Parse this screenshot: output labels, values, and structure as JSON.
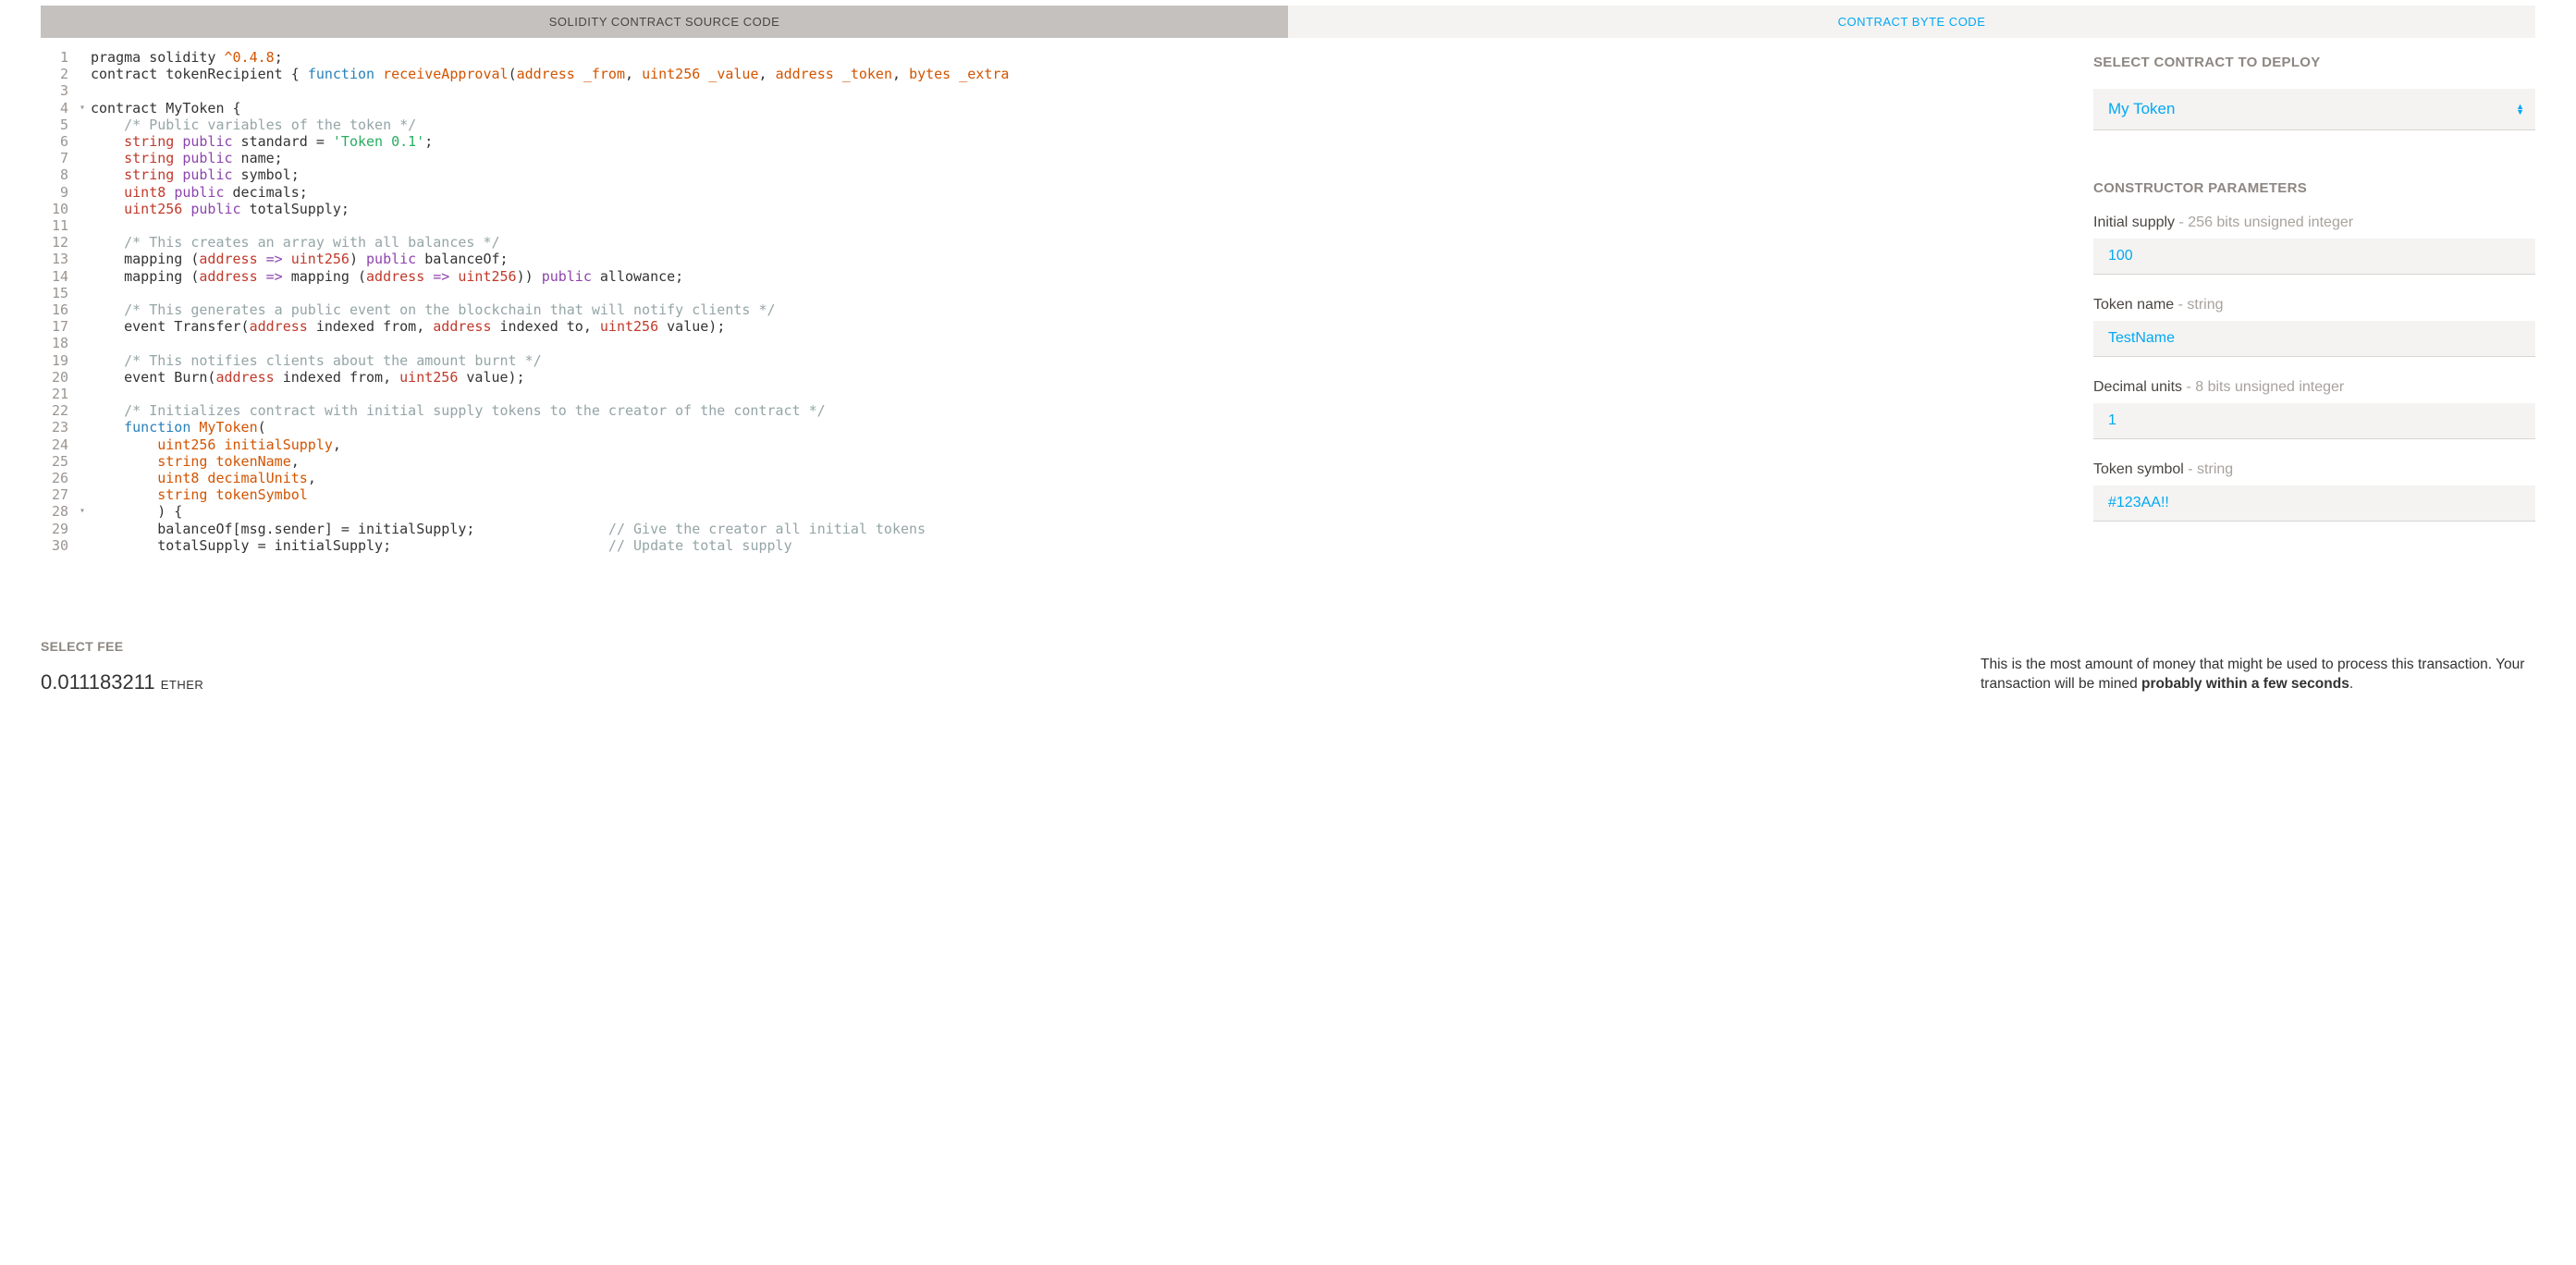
{
  "tabs": {
    "source_label": "SOLIDITY CONTRACT SOURCE CODE",
    "bytecode_label": "CONTRACT BYTE CODE"
  },
  "code": {
    "lines": [
      {
        "n": 1,
        "fold": "",
        "html": "pragma solidity <span class='tok-ver'>^0.4.8</span>;"
      },
      {
        "n": 2,
        "fold": "",
        "html": "contract tokenRecipient { <span class='tok-blue'>function</span> <span class='tok-fn'>receiveApproval</span>(<span class='tok-addr'>address _from</span>, <span class='tok-addr'>uint256 _value</span>, <span class='tok-addr'>address _token</span>, <span class='tok-addr'>bytes _extra</span>"
      },
      {
        "n": 3,
        "fold": "",
        "html": ""
      },
      {
        "n": 4,
        "fold": "▾",
        "html": "contract MyToken {"
      },
      {
        "n": 5,
        "fold": "",
        "html": "    <span class='tok-cmt'>/* Public variables of the token */</span>"
      },
      {
        "n": 6,
        "fold": "",
        "html": "    <span class='tok-type'>string</span> <span class='tok-kw'>public</span> standard = <span class='tok-str'>'Token 0.1'</span>;"
      },
      {
        "n": 7,
        "fold": "",
        "html": "    <span class='tok-type'>string</span> <span class='tok-kw'>public</span> name;"
      },
      {
        "n": 8,
        "fold": "",
        "html": "    <span class='tok-type'>string</span> <span class='tok-kw'>public</span> symbol;"
      },
      {
        "n": 9,
        "fold": "",
        "html": "    <span class='tok-type'>uint8</span> <span class='tok-kw'>public</span> decimals;"
      },
      {
        "n": 10,
        "fold": "",
        "html": "    <span class='tok-type'>uint256</span> <span class='tok-kw'>public</span> totalSupply;"
      },
      {
        "n": 11,
        "fold": "",
        "html": ""
      },
      {
        "n": 12,
        "fold": "",
        "html": "    <span class='tok-cmt'>/* This creates an array with all balances */</span>"
      },
      {
        "n": 13,
        "fold": "",
        "html": "    mapping (<span class='tok-type'>address</span> <span class='tok-kw'>=&gt;</span> <span class='tok-type'>uint256</span>) <span class='tok-kw'>public</span> balanceOf;"
      },
      {
        "n": 14,
        "fold": "",
        "html": "    mapping (<span class='tok-type'>address</span> <span class='tok-kw'>=&gt;</span> mapping (<span class='tok-type'>address</span> <span class='tok-kw'>=&gt;</span> <span class='tok-type'>uint256</span>)) <span class='tok-kw'>public</span> allowance;"
      },
      {
        "n": 15,
        "fold": "",
        "html": ""
      },
      {
        "n": 16,
        "fold": "",
        "html": "    <span class='tok-cmt'>/* This generates a public event on the blockchain that will notify clients */</span>"
      },
      {
        "n": 17,
        "fold": "",
        "html": "    event Transfer(<span class='tok-type'>address</span> indexed from, <span class='tok-type'>address</span> indexed to, <span class='tok-type'>uint256</span> value);"
      },
      {
        "n": 18,
        "fold": "",
        "html": ""
      },
      {
        "n": 19,
        "fold": "",
        "html": "    <span class='tok-cmt'>/* This notifies clients about the amount burnt */</span>"
      },
      {
        "n": 20,
        "fold": "",
        "html": "    event Burn(<span class='tok-type'>address</span> indexed from, <span class='tok-type'>uint256</span> value);"
      },
      {
        "n": 21,
        "fold": "",
        "html": ""
      },
      {
        "n": 22,
        "fold": "",
        "html": "    <span class='tok-cmt'>/* Initializes contract with initial supply tokens to the creator of the contract */</span>"
      },
      {
        "n": 23,
        "fold": "",
        "html": "    <span class='tok-blue'>function</span> <span class='tok-fn'>MyToken</span>("
      },
      {
        "n": 24,
        "fold": "",
        "html": "        <span class='tok-addr'>uint256 initialSupply</span>,"
      },
      {
        "n": 25,
        "fold": "",
        "html": "        <span class='tok-addr'>string tokenName</span>,"
      },
      {
        "n": 26,
        "fold": "",
        "html": "        <span class='tok-addr'>uint8 decimalUnits</span>,"
      },
      {
        "n": 27,
        "fold": "",
        "html": "        <span class='tok-addr'>string tokenSymbol</span>"
      },
      {
        "n": 28,
        "fold": "▾",
        "html": "        ) {"
      },
      {
        "n": 29,
        "fold": "",
        "html": "        balanceOf[msg.sender] = initialSupply;                <span class='tok-cmt'>// Give the creator all initial tokens</span>"
      },
      {
        "n": 30,
        "fold": "",
        "html": "        totalSupply = initialSupply;                          <span class='tok-cmt'>// Update total supply</span>"
      }
    ]
  },
  "side": {
    "select_contract_label": "SELECT CONTRACT TO DEPLOY",
    "selected_contract": "My Token",
    "constructor_label": "CONSTRUCTOR PARAMETERS",
    "params": [
      {
        "label": "Initial supply",
        "hint": " - 256 bits unsigned integer",
        "value": "100"
      },
      {
        "label": "Token name",
        "hint": " - string",
        "value": "TestName"
      },
      {
        "label": "Decimal units",
        "hint": " - 8 bits unsigned integer",
        "value": "1"
      },
      {
        "label": "Token symbol",
        "hint": " - string",
        "value": "#123AA!!"
      }
    ]
  },
  "fee": {
    "select_fee_label": "SELECT FEE",
    "amount": "0.011183211",
    "unit": "ETHER",
    "desc_prefix": "This is the most amount of money that might be used to process this transaction. Your transaction will be mined ",
    "desc_strong": "probably within a few seconds",
    "desc_suffix": "."
  }
}
